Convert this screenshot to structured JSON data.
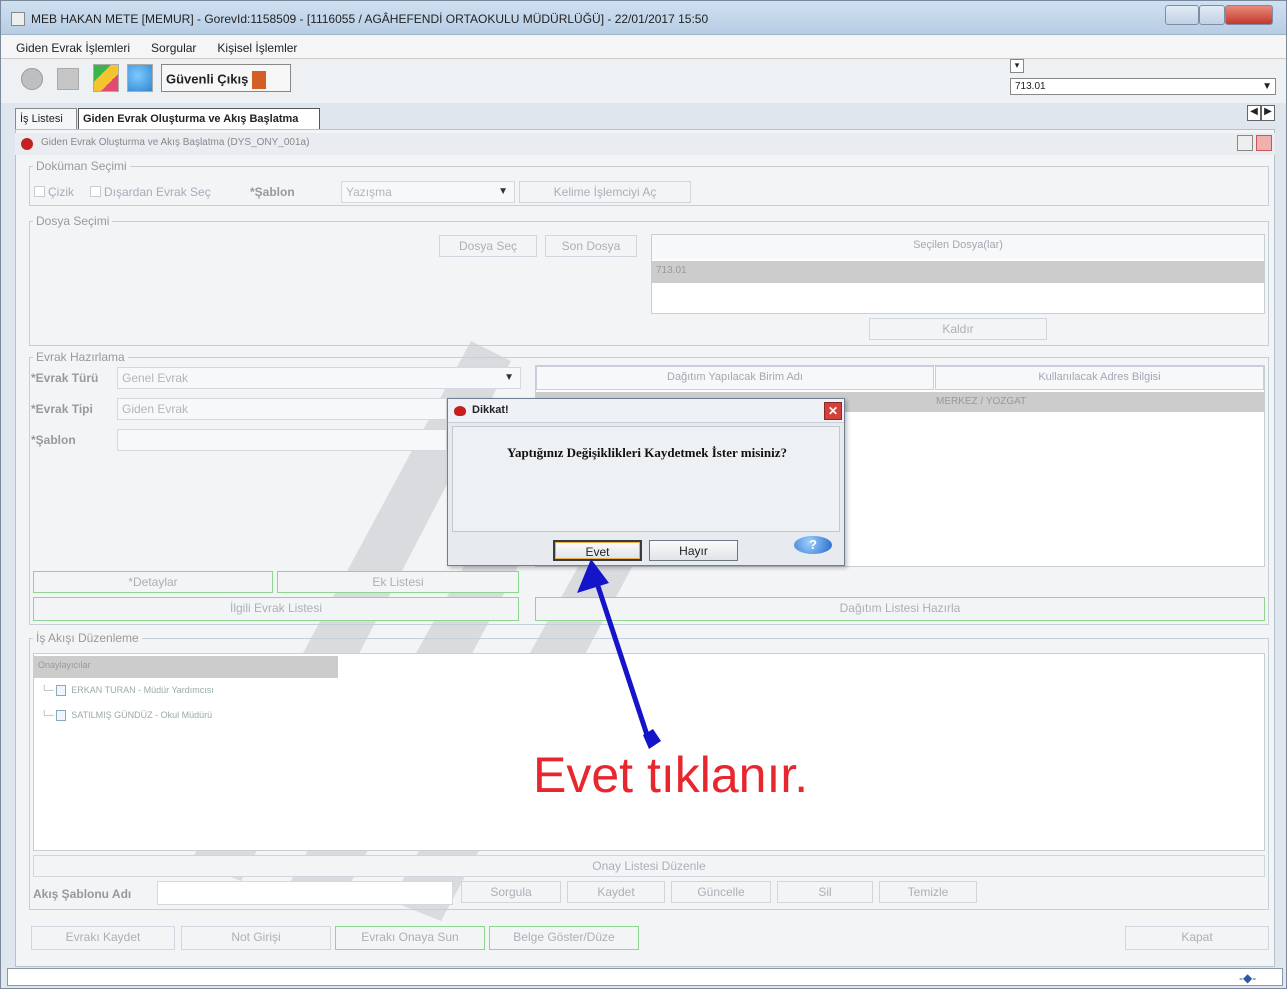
{
  "window": {
    "title": "MEB  HAKAN METE  [MEMUR] - GorevId:1158509 - [1116055 / AGÂHEFENDİ ORTAOKULU MÜDÜRLÜĞÜ] - 22/01/2017 15:50"
  },
  "menu": [
    "Giden Evrak İşlemleri",
    "Sorgular",
    "Kişisel İşlemler"
  ],
  "toolbar": {
    "exit_label": "Güvenli Çıkış",
    "combo_value": "713.01"
  },
  "tabs": [
    {
      "label": "İş Listesi",
      "active": false
    },
    {
      "label": "Giden Evrak Oluşturma ve Akış Başlatma",
      "active": true
    }
  ],
  "panel": {
    "title": "Giden Evrak Oluşturma ve Akış Başlatma (DYS_ONY_001a)"
  },
  "dokuman": {
    "legend": "Doküman Seçimi",
    "cizik": "Çizik",
    "disardan": "Dışardan Evrak Seç",
    "sablon_label": "Şablon",
    "sablon_value": "Yazışma",
    "kelime_btn": "Kelime İşlemciyi Aç"
  },
  "dosya": {
    "legend": "Dosya Seçimi",
    "dosya_sec": "Dosya Seç",
    "son_dosya": "Son Dosya",
    "secilen_header": "Seçilen Dosya(lar)",
    "secilen_row": "713.01",
    "kaldir": "Kaldır"
  },
  "evrak": {
    "legend": "Evrak Hazırlama",
    "turu_label": "Evrak Türü",
    "turu_value": "Genel Evrak",
    "tipi_label": "Evrak Tipi",
    "tipi_value": "Giden Evrak",
    "sablon_label": "Şablon",
    "dagitim_header": "Dağıtım Yapılacak Birim Adı",
    "adres_header": "Kullanılacak Adres Bilgisi",
    "adres_row": "MERKEZ / YOZGAT",
    "detaylar": "Detaylar",
    "ek_listesi": "Ek Listesi",
    "ilgili": "İlgili Evrak Listesi",
    "dagitim_hazirla": "Dağıtım Listesi Hazırla"
  },
  "isakisi": {
    "legend": "İş Akışı Düzenleme",
    "header": "Onaylayıcılar",
    "items": [
      "ERKAN TURAN - Müdür Yardımcısı",
      "SATILMIŞ GÜNDÜZ - Okul Müdürü"
    ],
    "onay_duzenle": "Onay Listesi Düzenle",
    "sablon_adi_label": "Akış Şablonu Adı",
    "sorgula": "Sorgula",
    "kaydet": "Kaydet",
    "guncelle": "Güncelle",
    "sil": "Sil",
    "temizle": "Temizle"
  },
  "bottom": {
    "evraki_kaydet": "Evrakı Kaydet",
    "not_girisi": "Not Girişi",
    "onaya_sun": "Evrakı Onaya Sun",
    "belge_goster": "Belge Göster/Düze",
    "kapat": "Kapat"
  },
  "dialog": {
    "title": "Dikkat!",
    "message": "Yaptığınız Değişiklikleri Kaydetmek İster misiniz?",
    "yes": "Evet",
    "no": "Hayır"
  },
  "annotation": "Evet tıklanır.",
  "colors": {
    "annotation_red": "#e8262e",
    "arrow_blue": "#1414c8",
    "green_border": "#8fd58f"
  }
}
